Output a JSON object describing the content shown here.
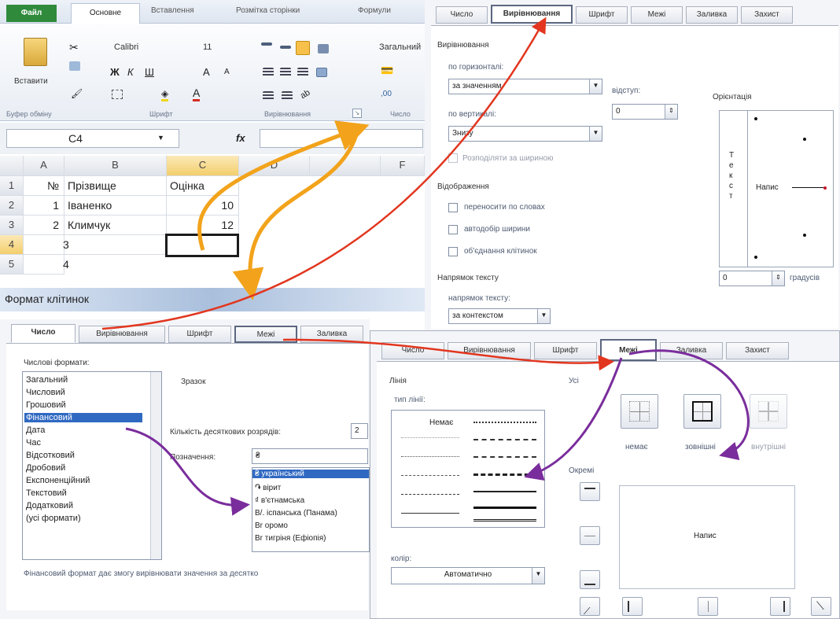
{
  "excel": {
    "tabs": [
      "Файл",
      "Основне",
      "Вставлення",
      "Розмітка сторінки",
      "Формули"
    ],
    "font_name": "Calibri",
    "font_size": "11",
    "number_format": "Загальний",
    "group_labels": [
      "Буфер обміну",
      "Шрифт",
      "Вирівнювання",
      "Число"
    ],
    "paste_label": "Вставити",
    "name_box": "C4",
    "fx": "fx",
    "col_headers": [
      "A",
      "B",
      "C",
      "D",
      "",
      "F"
    ],
    "rows": [
      {
        "num": "1",
        "a": "№",
        "b": "Прізвище",
        "c": "Оцінка"
      },
      {
        "num": "2",
        "a": "1",
        "b": "Іваненко",
        "c": "10"
      },
      {
        "num": "3",
        "a": "2",
        "b": "Климчук",
        "c": "12"
      },
      {
        "num": "4",
        "a": "3",
        "b": "",
        "c": ""
      },
      {
        "num": "5",
        "a": "4",
        "b": "",
        "c": ""
      }
    ],
    "dialog_bar": "Формат клітинок"
  },
  "align_dialog": {
    "tabs": [
      "Число",
      "Вирівнювання",
      "Шрифт",
      "Межі",
      "Заливка",
      "Захист"
    ],
    "section_align": "Вирівнювання",
    "horiz_label": "по горизонталі:",
    "horiz_value": "за значенням",
    "indent_label": "відступ:",
    "indent_value": "0",
    "vert_label": "по вертикалі:",
    "vert_value": "Знизу",
    "distribute_label": "Розподіляти за шириною",
    "section_display": "Відображення",
    "wrap_label": "переносити по словах",
    "shrink_label": "автодобір ширини",
    "merge_label": "об'єднання клітинок",
    "section_direction": "Напрямок тексту",
    "direction_label": "напрямок тексту:",
    "direction_value": "за контекстом",
    "orientation_label": "Орієнтація",
    "vertical_text": "Т е к с т",
    "orient_text": "Напис",
    "degrees_value": "0",
    "degrees_label": "градусів"
  },
  "number_dialog": {
    "tabs": [
      "Число",
      "Вирівнювання",
      "Шрифт",
      "Межі",
      "Заливка"
    ],
    "formats_label": "Числові формати:",
    "formats": [
      "Загальний",
      "Числовий",
      "Грошовий",
      "Фінансовий",
      "Дата",
      "Час",
      "Відсотковий",
      "Дробовий",
      "Експоненційний",
      "Текстовий",
      "Додатковий",
      "(усі формати)"
    ],
    "selected_format": "Фінансовий",
    "sample_label": "Зразок",
    "decimals_label": "Кількість десяткових розрядів:",
    "decimals_value": "2",
    "symbol_label": "Позначення:",
    "symbol_value": "₴",
    "symbols": [
      "₴ український",
      "֏ вірит",
      "₫ в'єтнамська",
      "B/. іспанська (Панама)",
      "Br оромо",
      "Br тигріня (Ефіопія)"
    ],
    "description": "Фінансовий формат дає змогу вирівнювати значення за десятко"
  },
  "border_dialog": {
    "tabs": [
      "Число",
      "Вирівнювання",
      "Шрифт",
      "Межі",
      "Заливка",
      "Захист"
    ],
    "line_label": "Лінія",
    "type_label": "тип лінії:",
    "none_label": "Немає",
    "presets_label": "Усі",
    "preset_none": "немає",
    "preset_outline": "зовнішні",
    "preset_inside": "внутрішні",
    "border_label": "Окремі",
    "preview_text": "Напис",
    "color_label": "колір:",
    "color_value": "Автоматично"
  },
  "arrows": {
    "orange": "#f2a31b",
    "red": "#e2361f",
    "purple": "#7a2d9c"
  }
}
